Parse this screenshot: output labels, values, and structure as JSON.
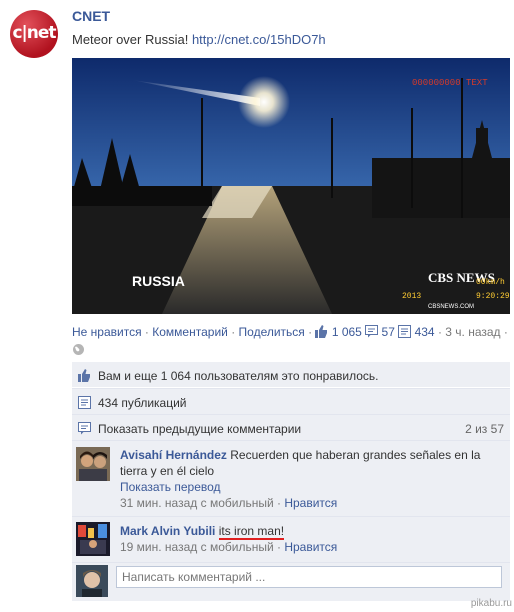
{
  "post": {
    "author": "CNET",
    "logo_text": "c|net",
    "text": "Meteor over Russia!",
    "link": "http://cnet.co/15hDO7h",
    "photo": {
      "caption": "RUSSIA",
      "brand": "CBS NEWS",
      "brand_sub": "CBSNEWS.COM",
      "counter": "000000000  TEXT",
      "stamp_1": "2013",
      "stamp_2": "00km/h",
      "stamp_3": "9:20:29"
    }
  },
  "actions": {
    "unlike": "Не нравится",
    "comment": "Комментарий",
    "share": "Поделиться",
    "likes": "1 065",
    "comments": "57",
    "shares": "434",
    "time": "3 ч. назад"
  },
  "likes_line": "Вам и еще 1 064 пользователям это понравилось.",
  "shares_line": "434 публикаций",
  "prev_comments": {
    "label": "Показать предыдущие комментарии",
    "count": "2 из 57"
  },
  "comments": [
    {
      "name": "Avisahí Hernández",
      "text": "Recuerden que haberan grandes señales en la tierra y en él cielo",
      "translate": "Показать перевод",
      "meta": "31 мин. назад с мобильный",
      "like": "Нравится"
    },
    {
      "name": "Mark Alvin Yubili",
      "text": "its iron man!",
      "meta": "19 мин. назад с мобильный",
      "like": "Нравится"
    }
  ],
  "input_placeholder": "Написать комментарий ...",
  "watermark": "pikabu.ru",
  "colors": {
    "link": "#3b5998",
    "panel": "#edeff4",
    "logo": "#b1121f",
    "underline": "#e02020"
  }
}
